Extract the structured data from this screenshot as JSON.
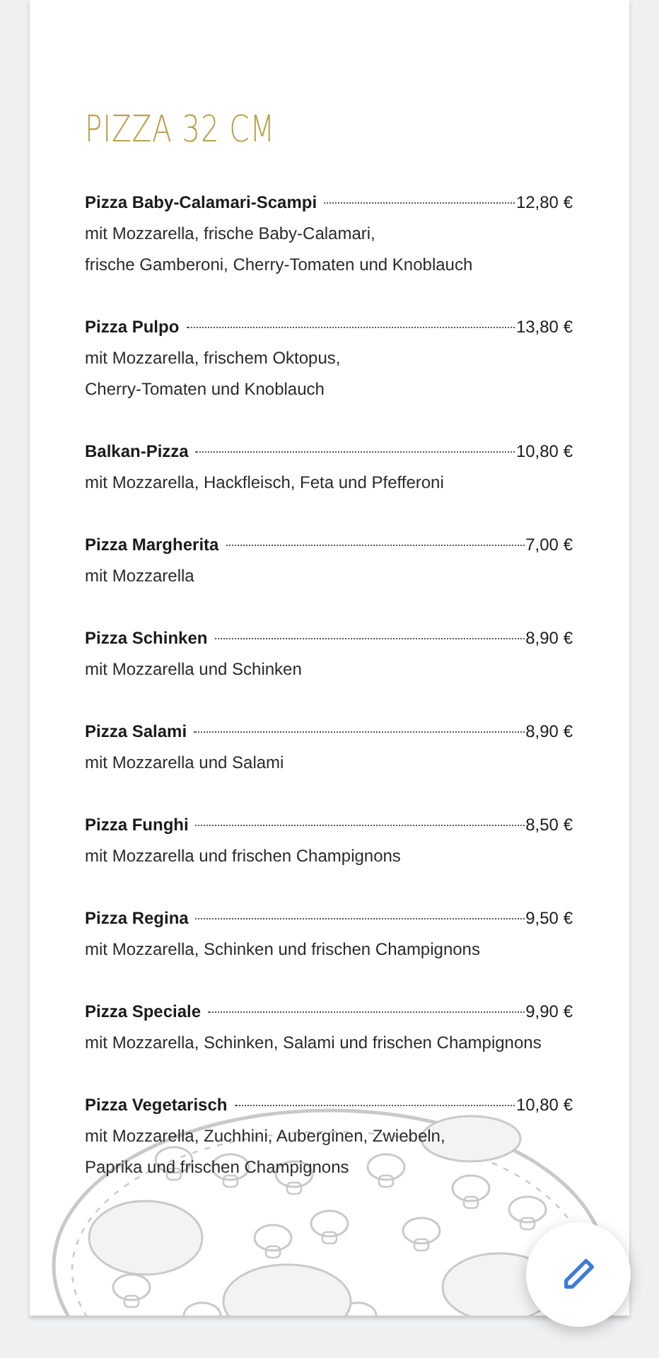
{
  "title": "PIZZA 32 CM",
  "items": [
    {
      "name": "Pizza Baby-Calamari-Scampi",
      "price": "12,80 €",
      "description": [
        "mit Mozzarella, frische Baby-Calamari,",
        "frische Gamberoni, Cherry-Tomaten und Knoblauch"
      ]
    },
    {
      "name": "Pizza Pulpo",
      "price": "13,80 €",
      "description": [
        "mit Mozzarella, frischem Oktopus,",
        "Cherry-Tomaten und Knoblauch"
      ]
    },
    {
      "name": "Balkan-Pizza",
      "price": "10,80 €",
      "description": [
        "mit Mozzarella, Hackfleisch, Feta und Pfefferoni"
      ]
    },
    {
      "name": "Pizza Margherita",
      "price": "7,00 €",
      "description": [
        "mit Mozzarella"
      ]
    },
    {
      "name": "Pizza Schinken",
      "price": "8,90 €",
      "description": [
        "mit Mozzarella und Schinken"
      ]
    },
    {
      "name": "Pizza Salami",
      "price": "8,90 €",
      "description": [
        "mit Mozzarella und Salami"
      ]
    },
    {
      "name": "Pizza Funghi",
      "price": "8,50 €",
      "description": [
        "mit Mozzarella und frischen Champignons"
      ]
    },
    {
      "name": "Pizza Regina",
      "price": "9,50 €",
      "description": [
        "mit Mozzarella, Schinken und frischen Champignons"
      ]
    },
    {
      "name": "Pizza Speciale",
      "price": "9,90 €",
      "description": [
        "mit Mozzarella, Schinken, Salami und frischen Champignons"
      ]
    },
    {
      "name": "Pizza Vegetarisch",
      "price": "10,80 €",
      "description": [
        "mit Mozzarella, Zuchhini, Auberginen, Zwiebeln,",
        "Paprika und frischen Champignons"
      ]
    }
  ]
}
